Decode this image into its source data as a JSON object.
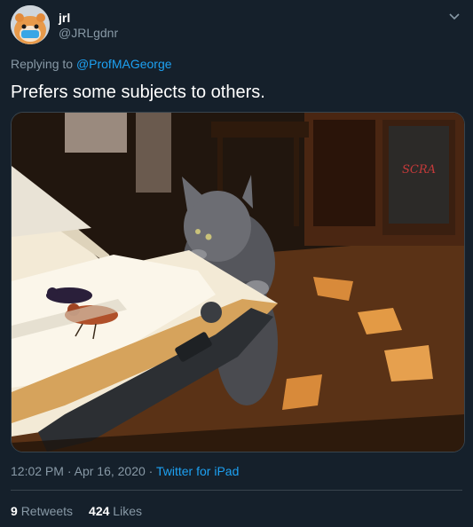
{
  "tweet": {
    "display_name": "jrl",
    "handle": "@JRLgdnr",
    "replying_prefix": "Replying to",
    "replying_to": "@ProfMAGeorge",
    "text": "Prefers some subjects to others.",
    "time": "12:02 PM",
    "date_sep": " · ",
    "date": "Apr 16, 2020",
    "source_sep": " · ",
    "source": "Twitter for iPad",
    "retweets_count": "9",
    "retweets_label": "Retweets",
    "likes_count": "424",
    "likes_label": "Likes",
    "media_book_text": "SCRA"
  },
  "icons": {
    "caret": "chevron-down-icon",
    "avatar": "hamster-avatar"
  },
  "colors": {
    "background": "#15202b",
    "link": "#1da1f2",
    "secondary_text": "#8899a6",
    "divider": "#38444d"
  }
}
